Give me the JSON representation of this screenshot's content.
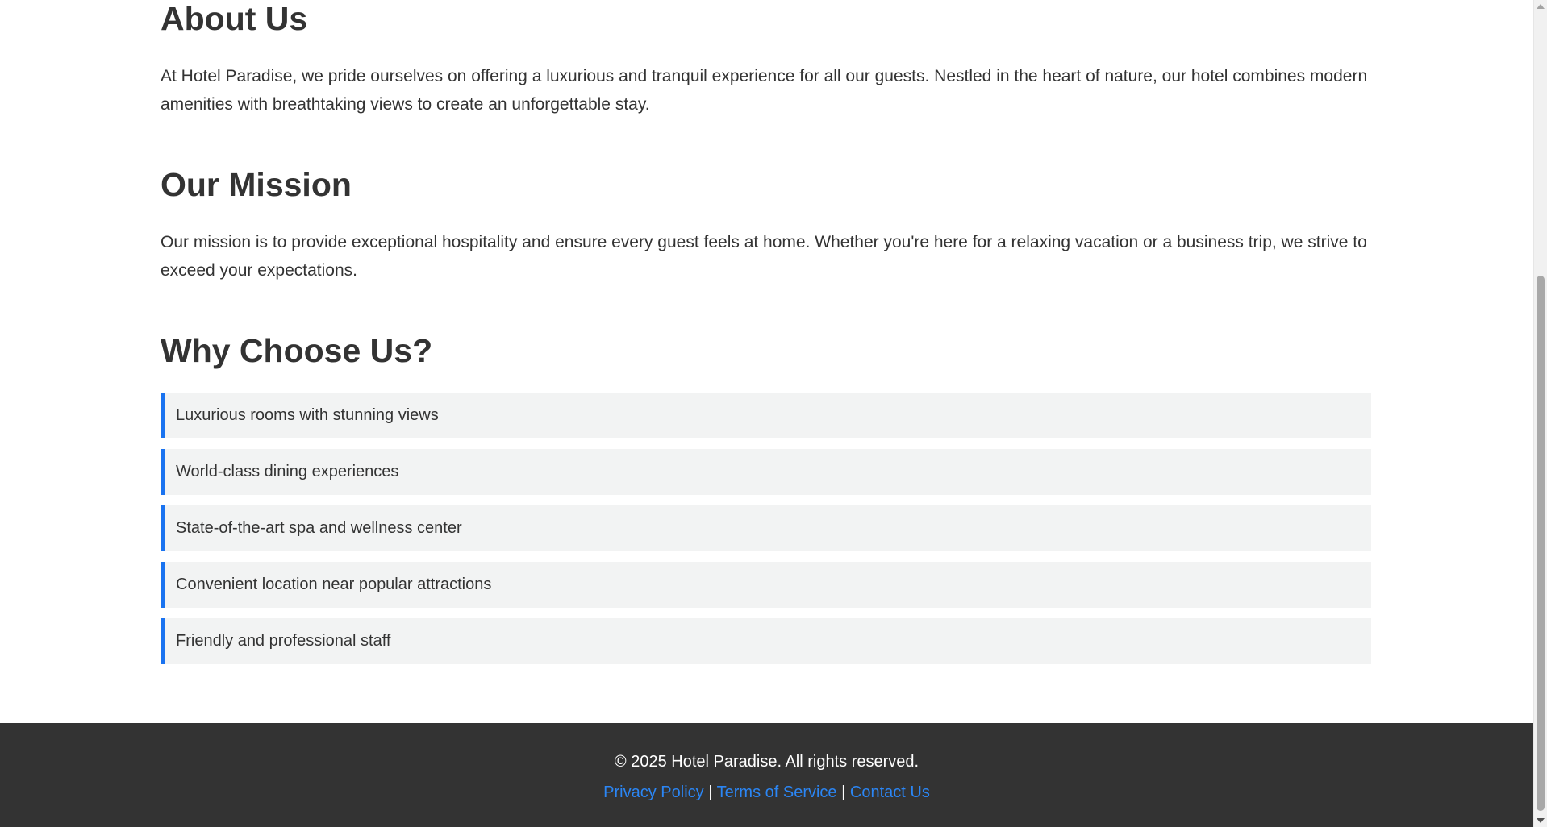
{
  "about": {
    "heading": "About Us",
    "text": "At Hotel Paradise, we pride ourselves on offering a luxurious and tranquil experience for all our guests. Nestled in the heart of nature, our hotel combines modern amenities with breathtaking views to create an unforgettable stay."
  },
  "mission": {
    "heading": "Our Mission",
    "text": "Our mission is to provide exceptional hospitality and ensure every guest feels at home. Whether you're here for a relaxing vacation or a business trip, we strive to exceed your expectations."
  },
  "why": {
    "heading": "Why Choose Us?",
    "items": [
      "Luxurious rooms with stunning views",
      "World-class dining experiences",
      "State-of-the-art spa and wellness center",
      "Convenient location near popular attractions",
      "Friendly and professional staff"
    ]
  },
  "footer": {
    "copyright": "© 2025 Hotel Paradise. All rights reserved.",
    "links": [
      "Privacy Policy",
      "Terms of Service",
      "Contact Us"
    ],
    "separator": "|"
  },
  "colors": {
    "accent": "#1a73f0",
    "link": "#2b86f5",
    "footer_bg": "#333333",
    "list_bg": "#f2f3f3"
  }
}
